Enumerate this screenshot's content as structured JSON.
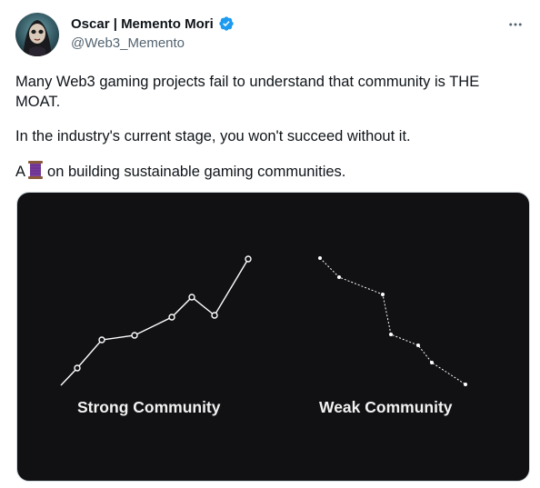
{
  "author": {
    "display_name": "Oscar | Memento Mori",
    "handle": "@Web3_Memento",
    "verified": true,
    "avatar_icon": "avatar-portrait-icon"
  },
  "tweet": {
    "paragraph_1": "Many Web3 gaming projects fail to understand that community is THE MOAT.",
    "paragraph_2": "In the industry's current stage, you won't succeed without it.",
    "paragraph_3_prefix": "A",
    "paragraph_3_icon": "thread-spool-icon",
    "paragraph_3_suffix": "on building sustainable gaming communities."
  },
  "media": {
    "left_caption": "Strong Community",
    "right_caption": "Weak Community",
    "background_color": "#111013",
    "line_color": "#ffffff"
  },
  "colors": {
    "verified_badge": "#1d9bf0",
    "handle_text": "#536471"
  }
}
